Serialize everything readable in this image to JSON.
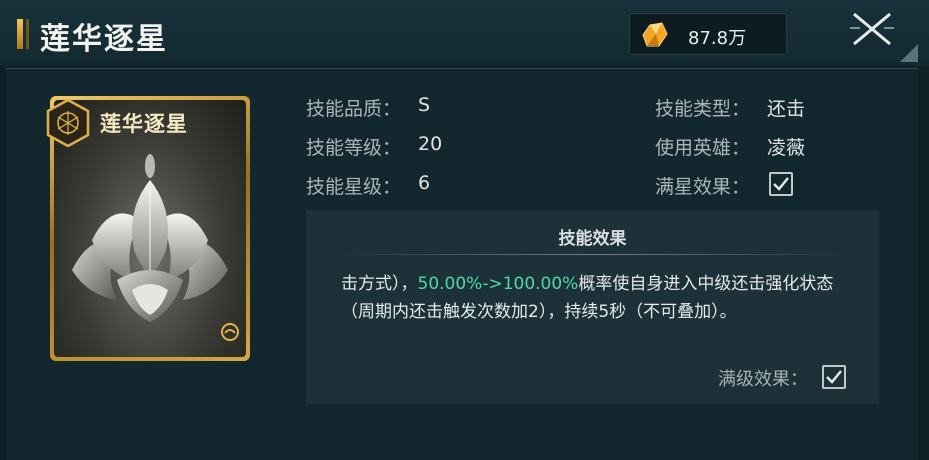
{
  "window": {
    "title": "莲华逐星",
    "close_icon": "close-x-icon"
  },
  "currency": {
    "icon": "crystal-icon",
    "value": "87.8万"
  },
  "card": {
    "name": "莲华逐星",
    "emblem_icon": "hexagon-emblem-icon",
    "art": "silver-lotus"
  },
  "info": {
    "quality_label": "技能品质：",
    "quality_value": "S",
    "level_label": "技能等级：",
    "level_value": "20",
    "star_label": "技能星级：",
    "star_value": "6",
    "type_label": "技能类型：",
    "type_value": "还击",
    "hero_label": "使用英雄：",
    "hero_value": "凌薇",
    "fullstar_label": "满星效果：",
    "fullstar_checked": true
  },
  "effect": {
    "title": "技能效果",
    "text_before": "击方式），",
    "highlight": "50.00%->100.00%",
    "text_after": "概率使自身进入中级还击强化状态（周期内还击触发次数加2），持续5秒（不可叠加）。",
    "maxlevel_label": "满级效果：",
    "maxlevel_checked": true
  },
  "colors": {
    "accent_gold": "#e8b94a",
    "highlight_green": "#4fd8a6",
    "panel_bg": "#13272e"
  }
}
